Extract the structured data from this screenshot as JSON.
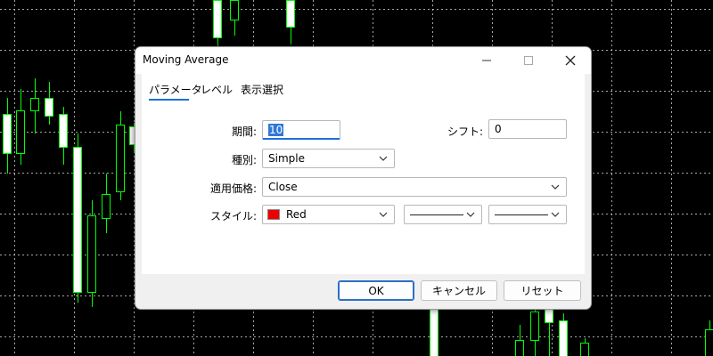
{
  "dialog": {
    "title": "Moving Average",
    "tabs": [
      {
        "label": "パラメータ",
        "active": true
      },
      {
        "label": "レベル",
        "active": false
      },
      {
        "label": "表示選択",
        "active": false
      }
    ],
    "fields": {
      "period": {
        "label": "期間:",
        "value": "10"
      },
      "shift": {
        "label": "シフト:",
        "value": "0"
      },
      "method": {
        "label": "種別:",
        "value": "Simple"
      },
      "apply_to": {
        "label": "適用価格:",
        "value": "Close"
      },
      "style": {
        "label": "スタイル:",
        "color_name": "Red",
        "color": "#ee0000"
      }
    },
    "buttons": {
      "ok": "OK",
      "cancel": "キャンセル",
      "reset": "リセット"
    }
  },
  "colors": {
    "candle_border": "#00ff00",
    "candle_bull": "#000000",
    "candle_bear": "#ffffff",
    "grid": "#d0d0d0",
    "background": "#000000",
    "accent": "#1e6fd9"
  },
  "icons": {
    "minimize": "minimize-icon",
    "maximize": "maximize-icon",
    "close": "close-icon",
    "dropdown": "chevron-down-icon"
  }
}
